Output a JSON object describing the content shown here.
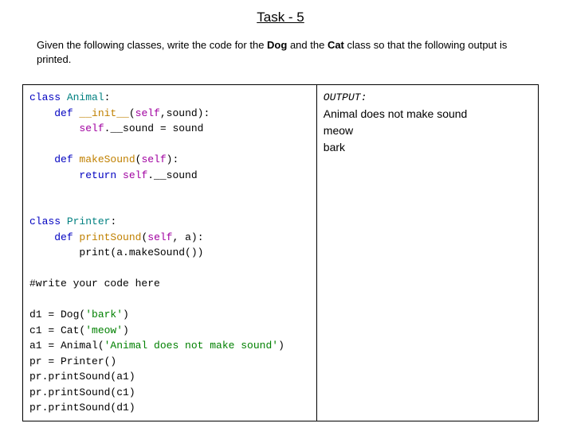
{
  "title": "Task - 5",
  "instructions_pre": "Given the following classes, write the code for the ",
  "instructions_dog": "Dog",
  "instructions_mid": " and the ",
  "instructions_cat": "Cat",
  "instructions_post": " class so that the following output is printed.",
  "code": {
    "l01_kw": "class",
    "l01_cls": " Animal",
    "l01_rest": ":",
    "l02_pad": "    ",
    "l02_kw": "def",
    "l02_def": " __init__",
    "l02_paren1": "(",
    "l02_self": "self",
    "l02_rest": ",sound):",
    "l03_pad": "        ",
    "l03_self": "self",
    "l03_rest": ".__sound = sound",
    "l04": "",
    "l05_pad": "    ",
    "l05_kw": "def",
    "l05_def": " makeSound",
    "l05_paren1": "(",
    "l05_self": "self",
    "l05_rest": "):",
    "l06_pad": "        ",
    "l06_kw": "return",
    "l06_self": " self",
    "l06_rest": ".__sound",
    "l07": "",
    "l08": "",
    "l09_kw": "class",
    "l09_cls": " Printer",
    "l09_rest": ":",
    "l10_pad": "    ",
    "l10_kw": "def",
    "l10_def": " printSound",
    "l10_paren1": "(",
    "l10_self": "self",
    "l10_rest": ", a):",
    "l11_pad": "        ",
    "l11_rest": "print(a.makeSound())",
    "l12": "",
    "l13": "#write your code here",
    "l14": "",
    "l15_a": "d1 = Dog(",
    "l15_s": "'bark'",
    "l15_b": ")",
    "l16_a": "c1 = Cat(",
    "l16_s": "'meow'",
    "l16_b": ")",
    "l17_a": "a1 = Animal(",
    "l17_s": "'Animal does not make sound'",
    "l17_b": ")",
    "l18": "pr = Printer()",
    "l19": "pr.printSound(a1)",
    "l20": "pr.printSound(c1)",
    "l21": "pr.printSound(d1)"
  },
  "output": {
    "header": "OUTPUT:",
    "l1": "Animal does not make sound",
    "l2": "meow",
    "l3": "bark"
  }
}
